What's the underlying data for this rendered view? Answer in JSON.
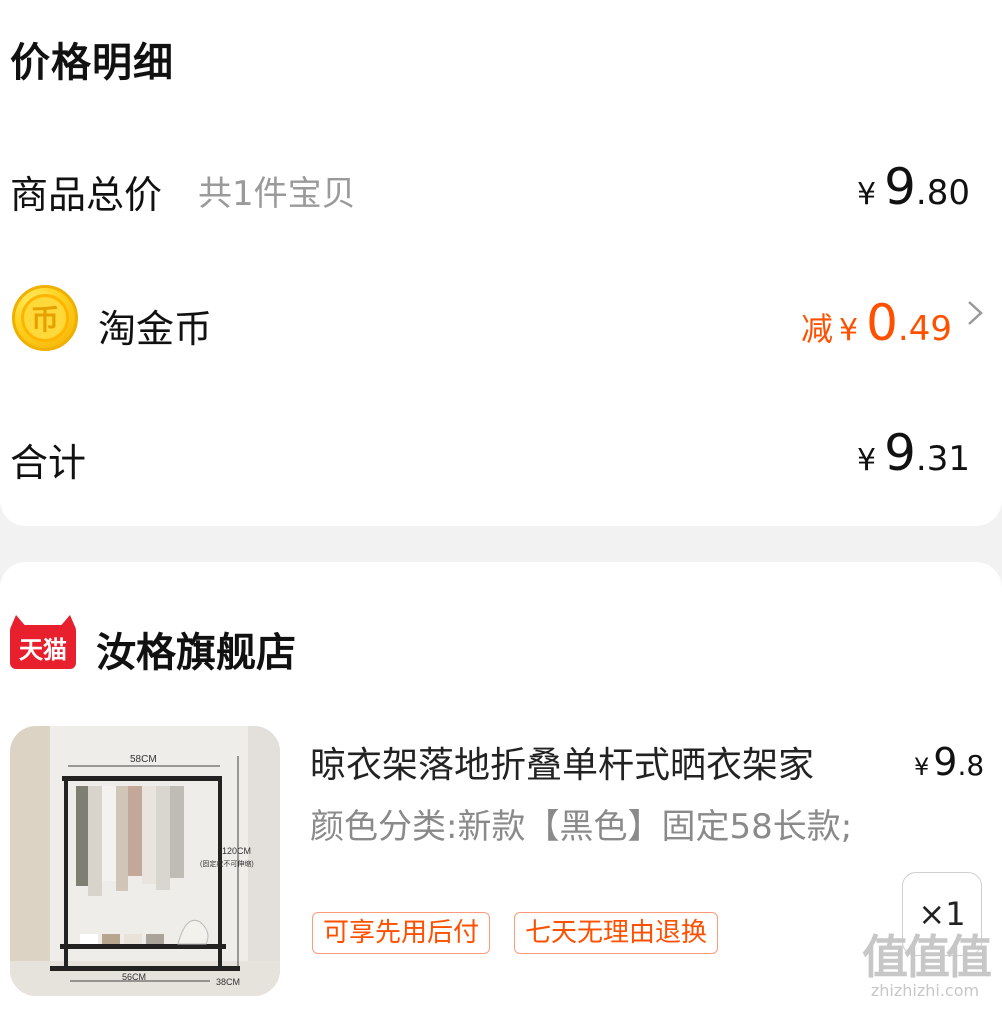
{
  "price_detail": {
    "title": "价格明细",
    "goods_total": {
      "label": "商品总价",
      "sub": "共1件宝贝",
      "yen": "¥",
      "int": "9",
      "dec": ".80"
    },
    "coin": {
      "icon_glyph": "币",
      "label": "淘金币",
      "prefix": "减",
      "yen": "¥",
      "int": "0",
      "dec": ".49"
    },
    "total": {
      "label": "合计",
      "yen": "¥",
      "int": "9",
      "dec": ".31"
    }
  },
  "shop": {
    "logo_text": "天猫",
    "name": "汝格旗舰店"
  },
  "item": {
    "title": "晾衣架落地折叠单杆式晒衣架家",
    "spec": "颜色分类:新款【黑色】固定58长款;",
    "price": {
      "yen": "¥",
      "int": "9",
      "dec": ".8"
    },
    "tags": [
      "可享先用后付",
      "七天无理由退换"
    ],
    "quantity": "×1",
    "image_labels": {
      "width": "58CM",
      "height": "120CM",
      "note": "(固定款不可伸缩)",
      "base_width": "56CM",
      "depth": "38CM"
    }
  },
  "watermark": {
    "big": "值值值",
    "small": "zhizhizhi.com"
  },
  "colors": {
    "accent": "#ff5000",
    "tmall_red": "#e8202e",
    "gray_text": "#9a9a9a",
    "background": "#f2f2f2"
  }
}
